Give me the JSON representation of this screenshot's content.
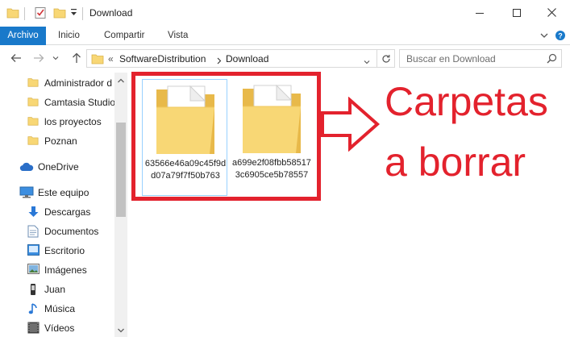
{
  "window": {
    "title": "Download"
  },
  "ribbon": {
    "tabs": [
      "Archivo",
      "Inicio",
      "Compartir",
      "Vista"
    ]
  },
  "address": {
    "overflow": "«",
    "parts": [
      "SoftwareDistribution",
      "Download"
    ]
  },
  "search": {
    "placeholder": "Buscar en Download"
  },
  "nav": {
    "quick_access": [
      {
        "label": "Administrador d",
        "icon": "folder-icon"
      },
      {
        "label": "Camtasia Studio",
        "icon": "folder-icon"
      },
      {
        "label": "los proyectos",
        "icon": "folder-icon"
      },
      {
        "label": "Poznan",
        "icon": "folder-icon"
      }
    ],
    "onedrive": {
      "label": "OneDrive",
      "icon": "cloud-icon"
    },
    "this_pc": {
      "label": "Este equipo",
      "icon": "computer-icon"
    },
    "pc_items": [
      {
        "label": "Descargas",
        "icon": "downloads-icon"
      },
      {
        "label": "Documentos",
        "icon": "documents-icon"
      },
      {
        "label": "Escritorio",
        "icon": "desktop-icon"
      },
      {
        "label": "Imágenes",
        "icon": "pictures-icon"
      },
      {
        "label": "Juan",
        "icon": "user-icon"
      },
      {
        "label": "Música",
        "icon": "music-icon"
      },
      {
        "label": "Vídeos",
        "icon": "videos-icon"
      }
    ]
  },
  "content": {
    "folders": [
      {
        "name": "63566e46a09c45f9dd07a79f7f50b763",
        "selected": true
      },
      {
        "name": "a699e2f08fbb585173c6905ce5b78557",
        "selected": false
      }
    ]
  },
  "annotation": {
    "line1": "Carpetas",
    "line2": "a borrar",
    "color": "#e3222d"
  },
  "colors": {
    "accent": "#1979ca",
    "folder": "#f8d775",
    "annotation": "#e3222d"
  }
}
